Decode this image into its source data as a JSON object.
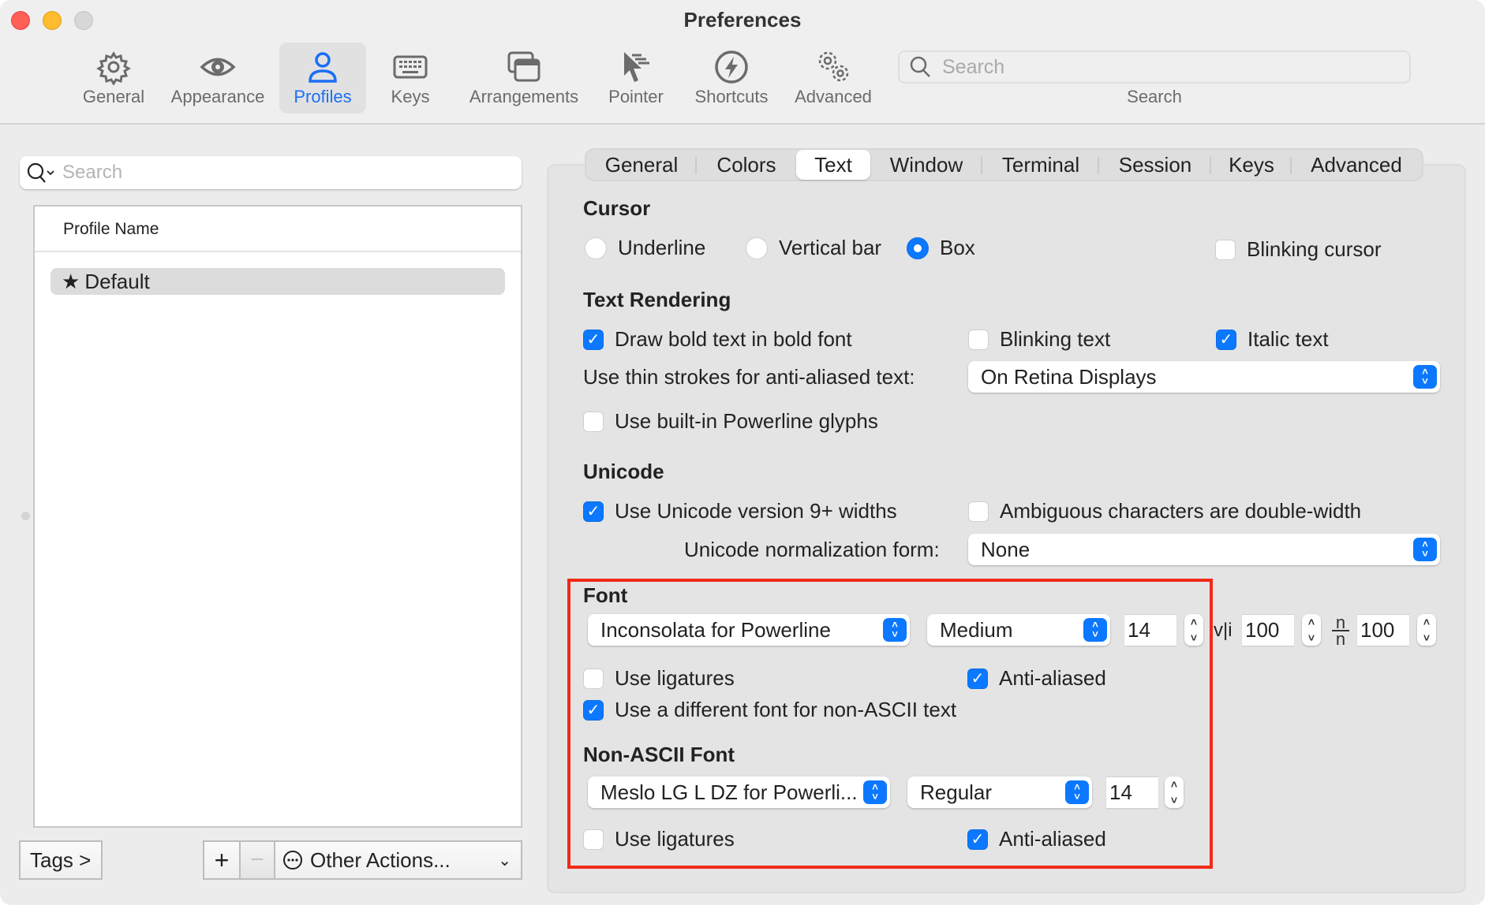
{
  "window": {
    "title": "Preferences",
    "traffic_lights": [
      "close",
      "minimize",
      "zoom"
    ]
  },
  "toolbar": {
    "items": [
      {
        "label": "General",
        "icon": "gear-icon"
      },
      {
        "label": "Appearance",
        "icon": "eye-icon"
      },
      {
        "label": "Profiles",
        "icon": "person-icon",
        "active": true
      },
      {
        "label": "Keys",
        "icon": "keyboard-icon"
      },
      {
        "label": "Arrangements",
        "icon": "windows-icon"
      },
      {
        "label": "Pointer",
        "icon": "pointer-icon"
      },
      {
        "label": "Shortcuts",
        "icon": "bolt-icon"
      },
      {
        "label": "Advanced",
        "icon": "gears-icon"
      }
    ],
    "search": {
      "placeholder": "Search",
      "label": "Search"
    }
  },
  "profiles": {
    "search_placeholder": "Search",
    "column_header": "Profile Name",
    "items": [
      {
        "name": "Default",
        "default": true,
        "selected": true
      }
    ],
    "buttons": {
      "tags": "Tags >",
      "add": "+",
      "remove": "−",
      "other_actions": "Other Actions..."
    }
  },
  "tabs": {
    "items": [
      "General",
      "Colors",
      "Text",
      "Window",
      "Terminal",
      "Session",
      "Keys",
      "Advanced"
    ],
    "active": "Text"
  },
  "cursor": {
    "title": "Cursor",
    "options": [
      "Underline",
      "Vertical bar",
      "Box"
    ],
    "selected": "Box",
    "blinking_label": "Blinking cursor",
    "blinking": false
  },
  "text_rendering": {
    "title": "Text Rendering",
    "draw_bold_label": "Draw bold text in bold font",
    "draw_bold": true,
    "blinking_text_label": "Blinking text",
    "blinking_text": false,
    "italic_label": "Italic text",
    "italic": true,
    "thin_strokes_label": "Use thin strokes for anti-aliased text:",
    "thin_strokes_value": "On Retina Displays",
    "powerline_label": "Use built-in Powerline glyphs",
    "powerline": false
  },
  "unicode": {
    "title": "Unicode",
    "widths_label": "Use Unicode version 9+ widths",
    "widths": true,
    "ambiguous_label": "Ambiguous characters are double-width",
    "ambiguous": false,
    "normalization_label": "Unicode normalization form:",
    "normalization_value": "None"
  },
  "font": {
    "title": "Font",
    "family": "Inconsolata for Powerline",
    "weight": "Medium",
    "size": "14",
    "hspacing_icon": "v|i",
    "hspacing": "100",
    "vspacing_icon": "n/n",
    "vspacing": "100",
    "ligatures_label": "Use ligatures",
    "ligatures": false,
    "antialiased_label": "Anti-aliased",
    "antialiased": true,
    "non_ascii_label": "Use a different font for non-ASCII text",
    "non_ascii": true
  },
  "non_ascii_font": {
    "title": "Non-ASCII Font",
    "family": "Meslo LG L DZ for Powerli...",
    "weight": "Regular",
    "size": "14",
    "ligatures_label": "Use ligatures",
    "ligatures": false,
    "antialiased_label": "Anti-aliased",
    "antialiased": true
  },
  "colors": {
    "accent": "#0b78ff",
    "highlight": "#f02a17",
    "active_tab_text": "#1a6ff4"
  }
}
